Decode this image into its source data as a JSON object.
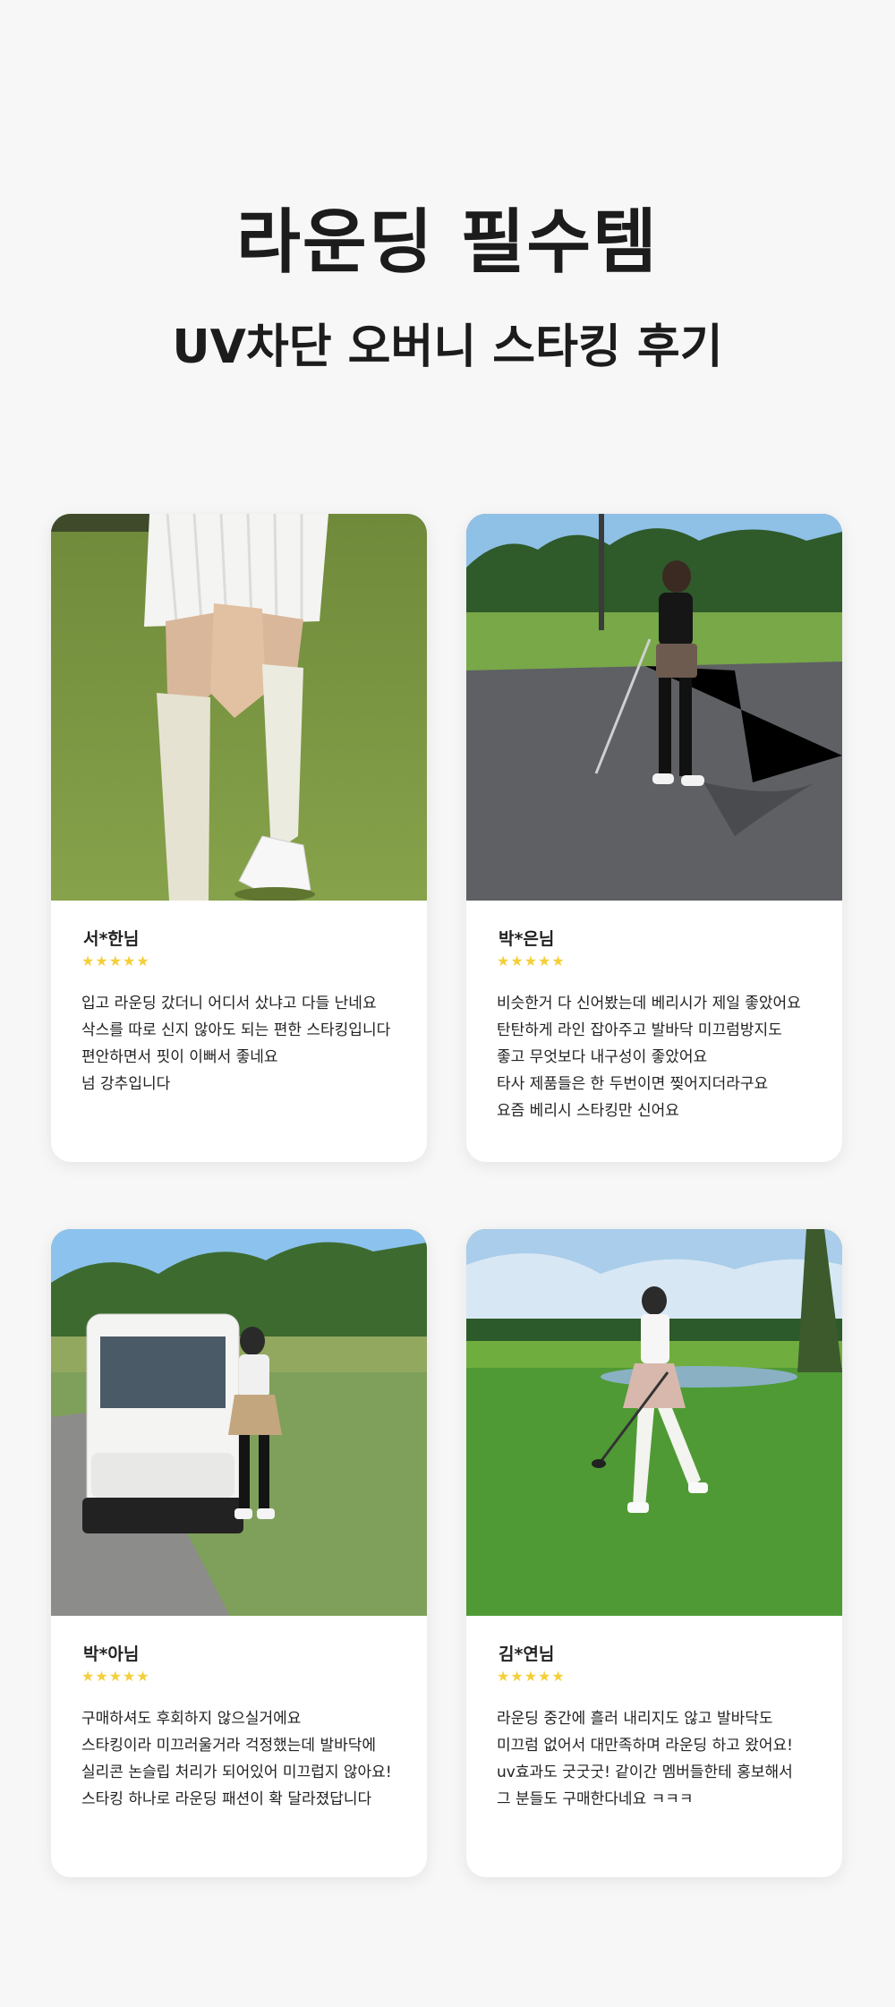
{
  "header": {
    "title": "라운딩 필수템",
    "subtitle": "UV차단 오버니 스타킹 후기"
  },
  "reviews": [
    {
      "name": "서*한님",
      "stars": "★★★★★",
      "lines": [
        "입고 라운딩 갔더니 어디서 샀냐고 다들 난네요",
        "삭스를 따로 신지 않아도 되는 편한 스타킹입니다",
        "편안하면서 핏이 이뻐서 좋네요",
        "넘 강추입니다"
      ]
    },
    {
      "name": "박*은님",
      "stars": "★★★★★",
      "lines": [
        "비슷한거 다 신어봤는데 베리시가 제일 좋았어요",
        "탄탄하게 라인 잡아주고 발바닥 미끄럼방지도",
        "좋고 무엇보다 내구성이 좋았어요",
        "타사 제품들은 한 두번이면 찢어지더라구요",
        "요즘 베리시 스타킹만 신어요"
      ]
    },
    {
      "name": "박*아님",
      "stars": "★★★★★",
      "lines": [
        "구매하셔도 후회하지 않으실거에요",
        "스타킹이라 미끄러울거라 걱정했는데 발바닥에",
        "실리콘 논슬립 처리가 되어있어 미끄럽지 않아요!",
        "스타킹 하나로 라운딩 패션이 확 달라졌답니다"
      ]
    },
    {
      "name": "김*연님",
      "stars": "★★★★★",
      "lines": [
        "라운딩 중간에 흘러 내리지도 않고 발바닥도",
        "미끄럼 없어서 대만족하며 라운딩 하고  왔어요!",
        "uv효과도 굿굿굿! 같이간 멤버들한테 홍보해서",
        "그 분들도 구매한다네요 ㅋㅋㅋ"
      ]
    }
  ]
}
